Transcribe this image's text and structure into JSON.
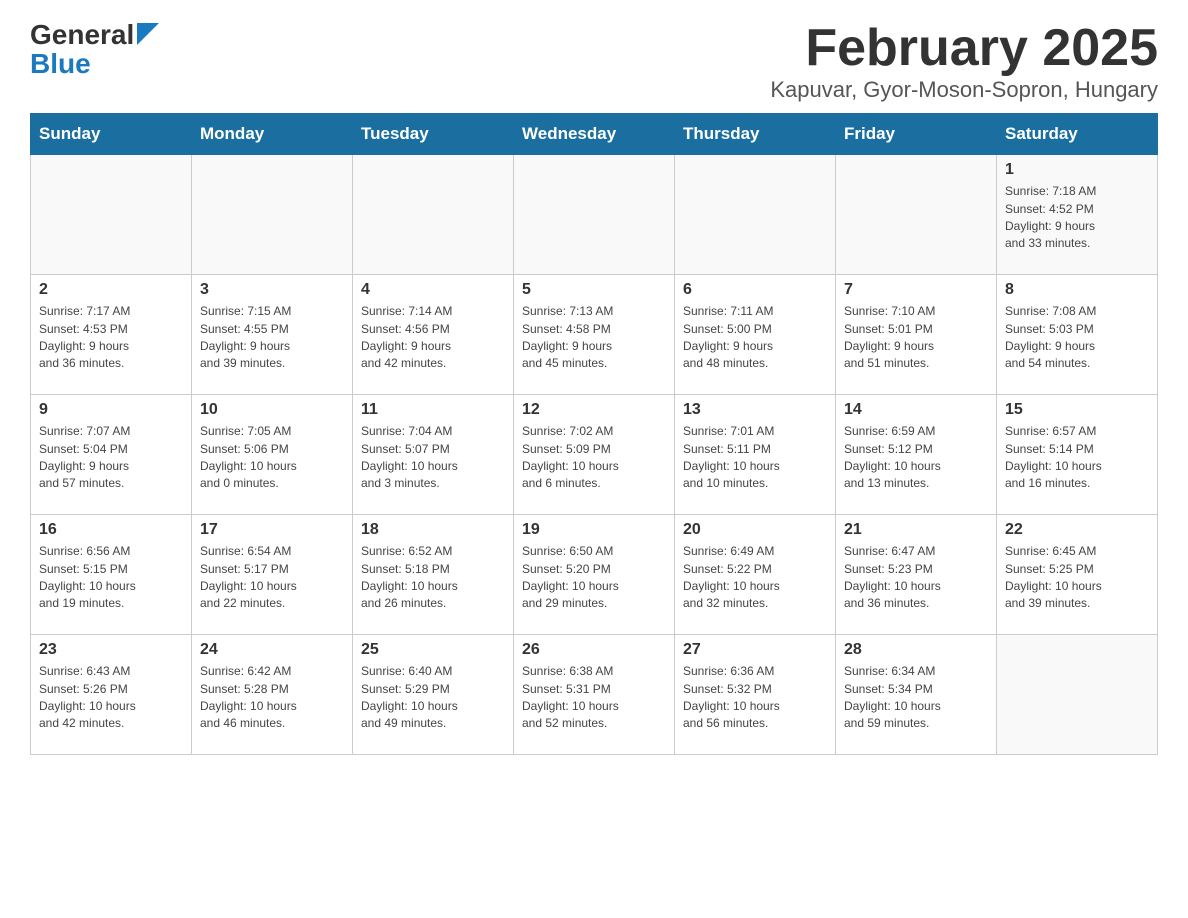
{
  "logo": {
    "general": "General",
    "blue": "Blue"
  },
  "title": "February 2025",
  "subtitle": "Kapuvar, Gyor-Moson-Sopron, Hungary",
  "days_of_week": [
    "Sunday",
    "Monday",
    "Tuesday",
    "Wednesday",
    "Thursday",
    "Friday",
    "Saturday"
  ],
  "weeks": [
    [
      {
        "day": "",
        "info": ""
      },
      {
        "day": "",
        "info": ""
      },
      {
        "day": "",
        "info": ""
      },
      {
        "day": "",
        "info": ""
      },
      {
        "day": "",
        "info": ""
      },
      {
        "day": "",
        "info": ""
      },
      {
        "day": "1",
        "info": "Sunrise: 7:18 AM\nSunset: 4:52 PM\nDaylight: 9 hours\nand 33 minutes."
      }
    ],
    [
      {
        "day": "2",
        "info": "Sunrise: 7:17 AM\nSunset: 4:53 PM\nDaylight: 9 hours\nand 36 minutes."
      },
      {
        "day": "3",
        "info": "Sunrise: 7:15 AM\nSunset: 4:55 PM\nDaylight: 9 hours\nand 39 minutes."
      },
      {
        "day": "4",
        "info": "Sunrise: 7:14 AM\nSunset: 4:56 PM\nDaylight: 9 hours\nand 42 minutes."
      },
      {
        "day": "5",
        "info": "Sunrise: 7:13 AM\nSunset: 4:58 PM\nDaylight: 9 hours\nand 45 minutes."
      },
      {
        "day": "6",
        "info": "Sunrise: 7:11 AM\nSunset: 5:00 PM\nDaylight: 9 hours\nand 48 minutes."
      },
      {
        "day": "7",
        "info": "Sunrise: 7:10 AM\nSunset: 5:01 PM\nDaylight: 9 hours\nand 51 minutes."
      },
      {
        "day": "8",
        "info": "Sunrise: 7:08 AM\nSunset: 5:03 PM\nDaylight: 9 hours\nand 54 minutes."
      }
    ],
    [
      {
        "day": "9",
        "info": "Sunrise: 7:07 AM\nSunset: 5:04 PM\nDaylight: 9 hours\nand 57 minutes."
      },
      {
        "day": "10",
        "info": "Sunrise: 7:05 AM\nSunset: 5:06 PM\nDaylight: 10 hours\nand 0 minutes."
      },
      {
        "day": "11",
        "info": "Sunrise: 7:04 AM\nSunset: 5:07 PM\nDaylight: 10 hours\nand 3 minutes."
      },
      {
        "day": "12",
        "info": "Sunrise: 7:02 AM\nSunset: 5:09 PM\nDaylight: 10 hours\nand 6 minutes."
      },
      {
        "day": "13",
        "info": "Sunrise: 7:01 AM\nSunset: 5:11 PM\nDaylight: 10 hours\nand 10 minutes."
      },
      {
        "day": "14",
        "info": "Sunrise: 6:59 AM\nSunset: 5:12 PM\nDaylight: 10 hours\nand 13 minutes."
      },
      {
        "day": "15",
        "info": "Sunrise: 6:57 AM\nSunset: 5:14 PM\nDaylight: 10 hours\nand 16 minutes."
      }
    ],
    [
      {
        "day": "16",
        "info": "Sunrise: 6:56 AM\nSunset: 5:15 PM\nDaylight: 10 hours\nand 19 minutes."
      },
      {
        "day": "17",
        "info": "Sunrise: 6:54 AM\nSunset: 5:17 PM\nDaylight: 10 hours\nand 22 minutes."
      },
      {
        "day": "18",
        "info": "Sunrise: 6:52 AM\nSunset: 5:18 PM\nDaylight: 10 hours\nand 26 minutes."
      },
      {
        "day": "19",
        "info": "Sunrise: 6:50 AM\nSunset: 5:20 PM\nDaylight: 10 hours\nand 29 minutes."
      },
      {
        "day": "20",
        "info": "Sunrise: 6:49 AM\nSunset: 5:22 PM\nDaylight: 10 hours\nand 32 minutes."
      },
      {
        "day": "21",
        "info": "Sunrise: 6:47 AM\nSunset: 5:23 PM\nDaylight: 10 hours\nand 36 minutes."
      },
      {
        "day": "22",
        "info": "Sunrise: 6:45 AM\nSunset: 5:25 PM\nDaylight: 10 hours\nand 39 minutes."
      }
    ],
    [
      {
        "day": "23",
        "info": "Sunrise: 6:43 AM\nSunset: 5:26 PM\nDaylight: 10 hours\nand 42 minutes."
      },
      {
        "day": "24",
        "info": "Sunrise: 6:42 AM\nSunset: 5:28 PM\nDaylight: 10 hours\nand 46 minutes."
      },
      {
        "day": "25",
        "info": "Sunrise: 6:40 AM\nSunset: 5:29 PM\nDaylight: 10 hours\nand 49 minutes."
      },
      {
        "day": "26",
        "info": "Sunrise: 6:38 AM\nSunset: 5:31 PM\nDaylight: 10 hours\nand 52 minutes."
      },
      {
        "day": "27",
        "info": "Sunrise: 6:36 AM\nSunset: 5:32 PM\nDaylight: 10 hours\nand 56 minutes."
      },
      {
        "day": "28",
        "info": "Sunrise: 6:34 AM\nSunset: 5:34 PM\nDaylight: 10 hours\nand 59 minutes."
      },
      {
        "day": "",
        "info": ""
      }
    ]
  ]
}
